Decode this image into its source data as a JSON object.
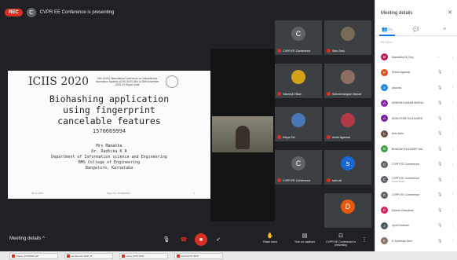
{
  "topbar": {
    "rec_label": "REC",
    "presenter_initial": "C",
    "presenting_text": "CVPR EE Conference is presenting"
  },
  "slide": {
    "logo": "ICIIS 2020",
    "conference": "15th (2020) International Conference on Industrial and Information Systems (ICIIS 2020) 26th to 28th November 2020, IIT Rupar, India",
    "title_lines": [
      "Biohashing application",
      "using fingerprint",
      "cancelable features"
    ],
    "paper_id": "1570669994",
    "authors": [
      "Mrs Mamatha",
      "Dr. Radhika K R",
      "Department of Information science and Engineering",
      "BMS College of Engineering",
      "Bangalore, Karnataka"
    ],
    "foot_left": "26-11-2020",
    "foot_mid": "Paper ID: 1570669994",
    "foot_right": "1"
  },
  "tiles": [
    {
      "name": "CVPR EE Conference",
      "initial": "C",
      "color": "#5f6368",
      "col": 0,
      "row": 0
    },
    {
      "name": "Setu Setu",
      "initial": "",
      "color": "#7a6a5a",
      "col": 1,
      "row": 0
    },
    {
      "name": "Sakeesh Hitam",
      "initial": "",
      "color": "#d4a017",
      "col": 0,
      "row": 1
    },
    {
      "name": "Subrahmanyam Mande",
      "initial": "",
      "color": "#8d6e63",
      "col": 1,
      "row": 1
    },
    {
      "name": "Divya Giri",
      "initial": "",
      "color": "#4a78b5",
      "col": 0,
      "row": 2
    },
    {
      "name": "Anish Agarwal",
      "initial": "",
      "color": "#b23a48",
      "col": 1,
      "row": 2
    },
    {
      "name": "CVPR EE Conference",
      "initial": "C",
      "color": "#5f6368",
      "col": 0,
      "row": 3
    },
    {
      "name": "sahi dzi",
      "initial": "s",
      "color": "#1967d2",
      "col": 1,
      "row": 3
    },
    {
      "name": "",
      "initial": "D",
      "color": "#e8590c",
      "col": 1,
      "row": 4
    }
  ],
  "bottombar": {
    "meeting_details": "Meeting details",
    "raise_hand": "Raise hand",
    "captions": "Turn on captions",
    "presenting": "CVPR EE Conference is presenting"
  },
  "side": {
    "title": "Meeting details",
    "tab_people_count": "(27)",
    "in_call_label": "IN CALL",
    "participants": [
      {
        "name": "Mamatha M (You)",
        "sub": "",
        "initial": "M",
        "color": "#c2185b"
      },
      {
        "name": "Preeti Agarwal",
        "sub": "",
        "initial": "P",
        "color": "#e64a19"
      },
      {
        "name": "anusha",
        "sub": "",
        "initial": "a",
        "color": "#1e88e5"
      },
      {
        "name": "ASHISH KUMAR ANSHU",
        "sub": "",
        "initial": "A",
        "color": "#8e24aa"
      },
      {
        "name": "ASHUTOSH KULKARNI",
        "sub": "",
        "initial": "A",
        "color": "#7b1fa2"
      },
      {
        "name": "betu betu",
        "sub": "",
        "initial": "b",
        "color": "#6d4c41"
      },
      {
        "name": "BHADAR KULDEEP MA...",
        "sub": "",
        "initial": "B",
        "color": "#43a047"
      },
      {
        "name": "CVPR EE Conference",
        "sub": "",
        "initial": "C",
        "color": "#5f6368"
      },
      {
        "name": "CVPR EE Conference",
        "sub": "Presentation",
        "initial": "C",
        "color": "#5f6368"
      },
      {
        "name": "CVPR EE Conference",
        "sub": "",
        "initial": "C",
        "color": "#5f6368"
      },
      {
        "name": "Deeba Chaudhari",
        "sub": "",
        "initial": "D",
        "color": "#d81b60"
      },
      {
        "name": "Jyoti Dodhani",
        "sub": "",
        "initial": "J",
        "color": "#455a64"
      },
      {
        "name": "K Jyothsna Devi",
        "sub": "",
        "initial": "K",
        "color": "#8d6e63"
      }
    ]
  },
  "taskbar": [
    "Paper_ICIIS2020.pdf",
    "conference 2020_B...",
    "Final_ICIIS 2020...",
    "Final ICIIS 2020..."
  ]
}
